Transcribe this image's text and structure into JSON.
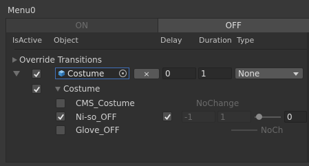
{
  "panel": {
    "title": "Menu0"
  },
  "tabs": [
    {
      "label": "ON",
      "active": false
    },
    {
      "label": "OFF",
      "active": true
    }
  ],
  "columns": {
    "is_active": "IsActive",
    "object": "Object",
    "delay": "Delay",
    "duration": "Duration",
    "type": "Type"
  },
  "override_transitions": {
    "label": "Override Transitions",
    "expanded": false
  },
  "entry": {
    "active": true,
    "object_name": "Costume",
    "remove_label": "×",
    "delay": "0",
    "duration": "1",
    "type_value": "None",
    "child_active": true,
    "child_label": "Costume"
  },
  "children": [
    {
      "name": "CMS_Costume",
      "checked": false,
      "status": "NoChange"
    },
    {
      "name": "Ni-so_OFF",
      "checked": true,
      "toggle": true,
      "min": "-1",
      "max": "1",
      "value": "0"
    },
    {
      "name": "Glove_OFF",
      "checked": false,
      "status": "NoCh"
    }
  ],
  "colors": {
    "accent": "#3f6fb8",
    "background": "#303030",
    "panel": "#383838"
  }
}
